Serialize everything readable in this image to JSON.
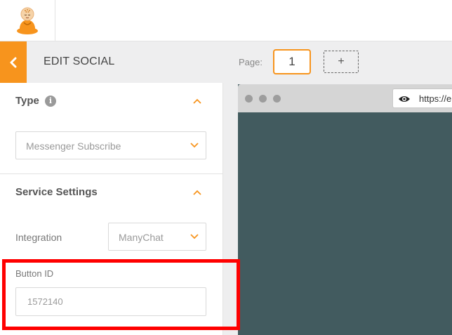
{
  "panel": {
    "title": "EDIT SOCIAL",
    "type_section": {
      "title": "Type",
      "info_glyph": "i",
      "select_value": "Messenger Subscribe"
    },
    "service_section": {
      "title": "Service Settings",
      "integration_label": "Integration",
      "integration_value": "ManyChat",
      "button_id_label": "Button ID",
      "button_id_value": "1572140"
    }
  },
  "pager": {
    "label": "Page:",
    "current": "1",
    "add_glyph": "+"
  },
  "preview": {
    "url_text": "https://e"
  },
  "colors": {
    "accent": "#f7941d",
    "preview_bg": "#425b5f",
    "highlight": "#ff0000"
  },
  "icons": [
    "monk-logo",
    "chevron-left-icon",
    "info-icon",
    "chevron-up-icon",
    "chevron-down-icon",
    "plus-icon",
    "eye-icon"
  ]
}
